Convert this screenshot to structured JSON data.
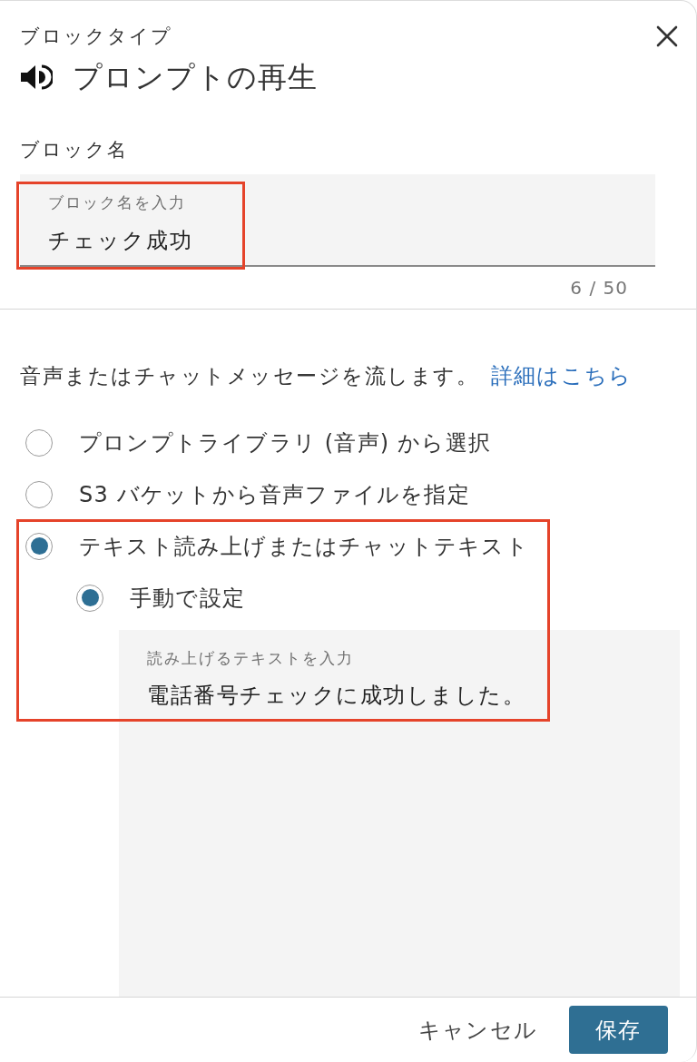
{
  "header": {
    "caption": "ブロックタイプ",
    "title": "プロンプトの再生"
  },
  "block_name": {
    "label": "ブロック名",
    "field": {
      "floating_label": "ブロック名を入力",
      "value": "チェック成功",
      "highlighted": true
    },
    "counter": "6 / 50"
  },
  "description": {
    "text": "音声またはチャットメッセージを流します。",
    "link": "詳細はこちら"
  },
  "options": [
    {
      "label": "プロンプトライブラリ (音声) から選択",
      "selected": false,
      "highlighted": false
    },
    {
      "label": "S3 バケットから音声ファイルを指定",
      "selected": false,
      "highlighted": false
    },
    {
      "label": "テキスト読み上げまたはチャットテキスト",
      "selected": true,
      "highlighted": true,
      "children": [
        {
          "label": "手動で設定",
          "selected": true,
          "text_field": {
            "floating_label": "読み上げるテキストを入力",
            "value": "電話番号チェックに成功しました。"
          }
        }
      ]
    }
  ],
  "footer": {
    "buttons": [
      {
        "label": "キャンセル",
        "kind": "secondary"
      },
      {
        "label": "保存",
        "kind": "primary"
      }
    ]
  }
}
